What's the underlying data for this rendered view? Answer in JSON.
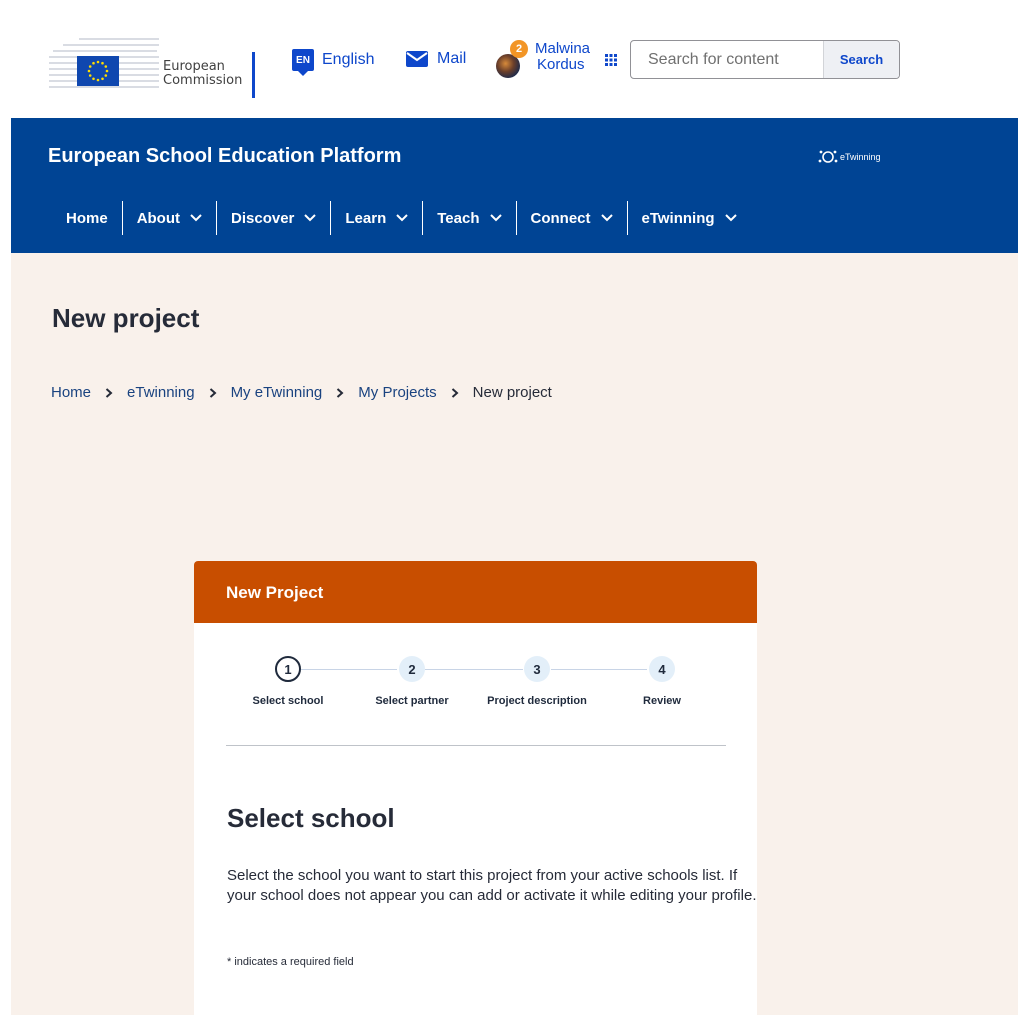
{
  "header": {
    "logo_line1": "European",
    "logo_line2": "Commission",
    "language_code": "EN",
    "language_label": "English",
    "mail_label": "Mail",
    "notification_count": "2",
    "user_first": "Malwina",
    "user_last": "Kordus",
    "search_placeholder": "Search for content",
    "search_button": "Search"
  },
  "banner": {
    "site_title": "European School Education Platform",
    "etwinning_logo": "eTwinning",
    "menu": [
      "Home",
      "About",
      "Discover",
      "Learn",
      "Teach",
      "Connect",
      "eTwinning"
    ]
  },
  "page": {
    "title": "New project",
    "breadcrumb": [
      "Home",
      "eTwinning",
      "My eTwinning",
      "My Projects",
      "New project"
    ]
  },
  "wizard": {
    "header": "New Project",
    "steps": [
      {
        "number": "1",
        "label": "Select school"
      },
      {
        "number": "2",
        "label": "Select partner"
      },
      {
        "number": "3",
        "label": "Project description"
      },
      {
        "number": "4",
        "label": "Review"
      }
    ],
    "active_step": 1,
    "section_title": "Select school",
    "description": "Select the school you want to start this project from your active schools list. If your school does not appear you can add or activate it while editing your profile.",
    "required_note": "* indicates a required field"
  },
  "colors": {
    "brand_blue": "#004494",
    "link_blue": "#0e47cb",
    "wizard_orange": "#c84e00",
    "page_bg": "#f9f1eb"
  }
}
